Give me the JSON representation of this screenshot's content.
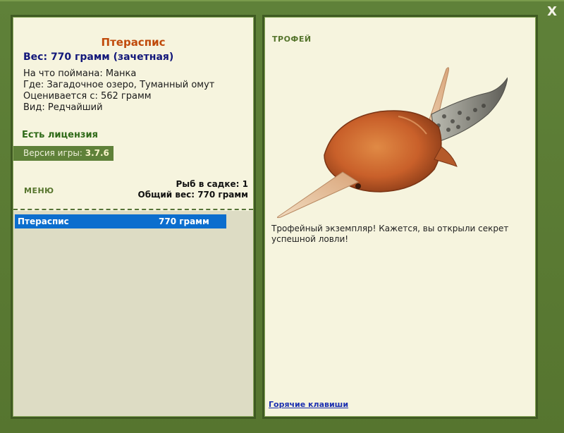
{
  "window": {
    "close_label": "X"
  },
  "fish": {
    "name": "Птераспис",
    "weight_line": "Вес: 770 грамм (зачетная)",
    "caught_on": "На что поймана: Манка",
    "location": "Где: Загадочное озеро, Туманный омут",
    "rated_from": "Оценивается с: 562 грамм",
    "kind": "Вид: Редчайший"
  },
  "license": "Есть лицензия",
  "version": {
    "label": "Версия игры:",
    "value": "3.7.6"
  },
  "menu_label": "МЕНЮ",
  "stats": {
    "fish_in_keepnet": "Рыб в садке: 1",
    "total_weight": "Общий вес: 770 грамм"
  },
  "list": [
    {
      "name": "Птераспис",
      "weight": "770 грамм"
    }
  ],
  "trophy": {
    "label": "ТРОФЕЙ",
    "text": "Трофейный экземпляр! Кажется, вы открыли секрет успешной ловли!",
    "image_icon": "pteraspis-fish-image"
  },
  "hotkeys_link": "Горячие клавиши",
  "colors": {
    "frame_green": "#5f8139",
    "panel_bg": "#f6f4de",
    "title_orange": "#c04a0b",
    "weight_blue": "#12177a",
    "selection_blue": "#0c6ece"
  }
}
